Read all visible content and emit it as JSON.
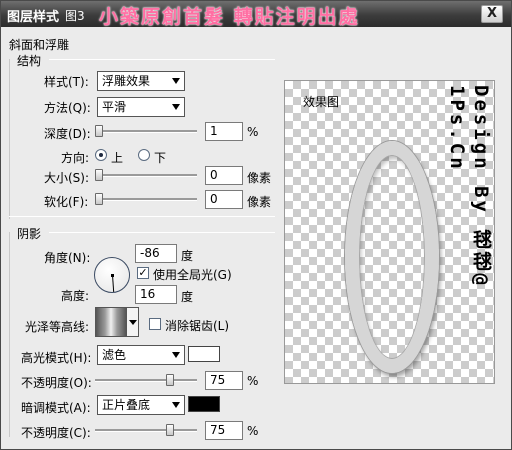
{
  "window": {
    "title": "图层样式",
    "figure_label": "图3",
    "banner": "小築原創首髮 轉貼注明出處",
    "close_label": "X"
  },
  "bevel": {
    "section_title": "斜面和浮雕",
    "structure_title": "结构",
    "style_label": "样式(T):",
    "style_value": "浮雕效果",
    "technique_label": "方法(Q):",
    "technique_value": "平滑",
    "depth_label": "深度(D):",
    "depth_value": "1",
    "depth_unit": "%",
    "depth_slider_fraction": 0,
    "direction_label": "方向:",
    "direction_up": "上",
    "direction_down": "下",
    "direction_selected": "up",
    "size_label": "大小(S):",
    "size_value": "0",
    "size_unit": "像素",
    "size_slider_fraction": 0,
    "soften_label": "软化(F):",
    "soften_value": "0",
    "soften_unit": "像素",
    "soften_slider_fraction": 0
  },
  "shading": {
    "section_title": "阴影",
    "angle_label": "角度(N):",
    "angle_value": "-86",
    "angle_unit": "度",
    "global_light_label": "使用全局光(G)",
    "global_light_checked": true,
    "altitude_label": "高度:",
    "altitude_value": "16",
    "altitude_unit": "度",
    "gloss_contour_label": "光泽等高线:",
    "anti_alias_label": "消除锯齿(L)",
    "anti_alias_checked": false,
    "highlight_mode_label": "高光模式(H):",
    "highlight_mode_value": "滤色",
    "highlight_color": "#ffffff",
    "highlight_opacity_label": "不透明度(O):",
    "highlight_opacity_value": "75",
    "highlight_opacity_unit": "%",
    "highlight_opacity_fraction": 0.75,
    "shadow_mode_label": "暗调模式(A):",
    "shadow_mode_value": "正片叠底",
    "shadow_color": "#000000",
    "shadow_opacity_label": "不透明度(C):",
    "shadow_opacity_value": "75",
    "shadow_opacity_unit": "%",
    "shadow_opacity_fraction": 0.75
  },
  "preview": {
    "label": "效果图",
    "watermark": "Design By 毬毬@ 1Ps.Cn"
  }
}
